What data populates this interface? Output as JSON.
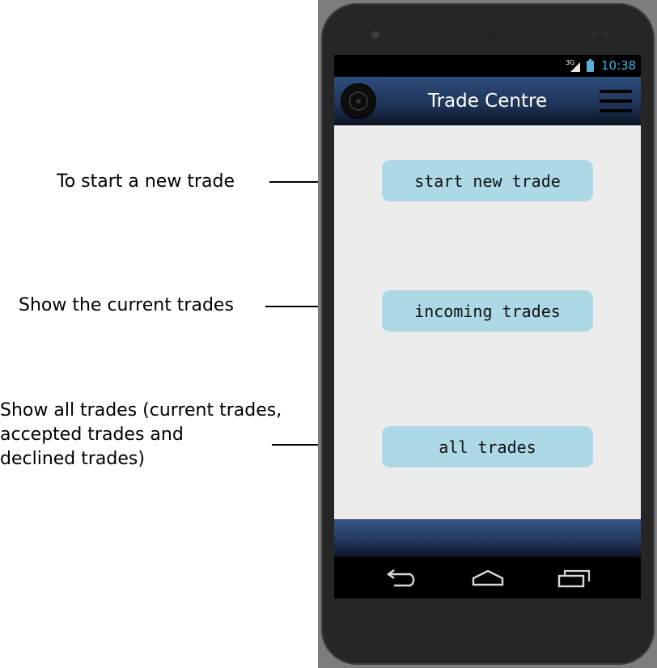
{
  "annotations": {
    "new_trade": "To start a new trade",
    "current_trades": "Show the current trades",
    "all_trades_line1": "Show all trades (current trades,",
    "all_trades_line2": "accepted trades and",
    "all_trades_line3": "declined trades)"
  },
  "status_bar": {
    "network": "3G",
    "time": "10:38"
  },
  "action_bar": {
    "title": "Trade Centre",
    "logo_icon": "vinyl-record-icon",
    "menu_icon": "hamburger-menu-icon"
  },
  "buttons": {
    "start_new_trade": "start new trade",
    "incoming_trades": "incoming trades",
    "all_trades": "all trades"
  },
  "nav_bar": {
    "back_icon": "back-icon",
    "home_icon": "home-icon",
    "recent_icon": "recent-apps-icon"
  },
  "colors": {
    "button_bg": "#add8e6",
    "action_bar": "#2f4e7d",
    "content_bg": "#ececec",
    "status_accent": "#33b5e5"
  }
}
